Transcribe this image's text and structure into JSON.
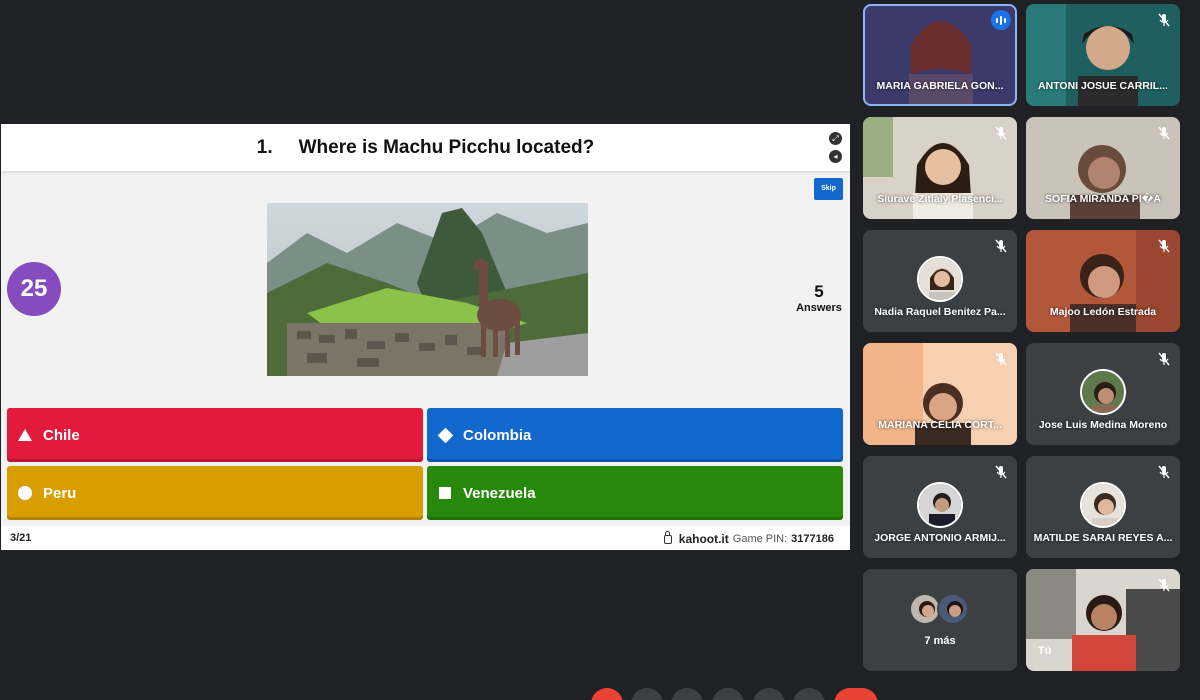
{
  "kahoot": {
    "question_number": "1.",
    "question_text": "Where is Machu Picchu located?",
    "skip_label": "Skip",
    "timer": "25",
    "answers_count": "5",
    "answers_label": "Answers",
    "options": [
      {
        "label": "Chile",
        "shape": "triangle",
        "color": "#e21b3c"
      },
      {
        "label": "Colombia",
        "shape": "diamond",
        "color": "#1368ce"
      },
      {
        "label": "Peru",
        "shape": "circle",
        "color": "#d89e00"
      },
      {
        "label": "Venezuela",
        "shape": "square",
        "color": "#26890c"
      }
    ],
    "progress": "3/21",
    "site": "kahoot.it",
    "pin_label": "Game PIN:",
    "pin_value": "3177186"
  },
  "participants": [
    {
      "name": "MARIA GABRIELA GON...",
      "status": "speaking"
    },
    {
      "name": "ANTONI JOSUE CARRIL...",
      "status": "muted"
    },
    {
      "name": "Siurave Zitlaly Plasenci...",
      "status": "muted"
    },
    {
      "name": "SOFIA MIRANDA PI�A",
      "status": "muted"
    },
    {
      "name": "Nadia Raquel Benitez Pa...",
      "status": "muted"
    },
    {
      "name": "Majoo Ledón Estrada",
      "status": "muted"
    },
    {
      "name": "MARIANA CELIA CORT...",
      "status": "muted"
    },
    {
      "name": "Jose Luis Medina Moreno",
      "status": "muted"
    },
    {
      "name": "JORGE ANTONIO ARMIJ...",
      "status": "muted"
    },
    {
      "name": "MATILDE SARAI REYES A...",
      "status": "muted"
    }
  ],
  "more_label": "7 más",
  "self_label": "Tú",
  "colors": {
    "meet_background": "#202124",
    "tile_background": "#3c4043",
    "timer": "#864cbf",
    "active_outline": "#8ab4f8",
    "end_call": "#ea4335"
  },
  "icons": [
    "mic-off-icon",
    "speaking-icon",
    "lock-icon",
    "play-icon",
    "skip-icon"
  ]
}
